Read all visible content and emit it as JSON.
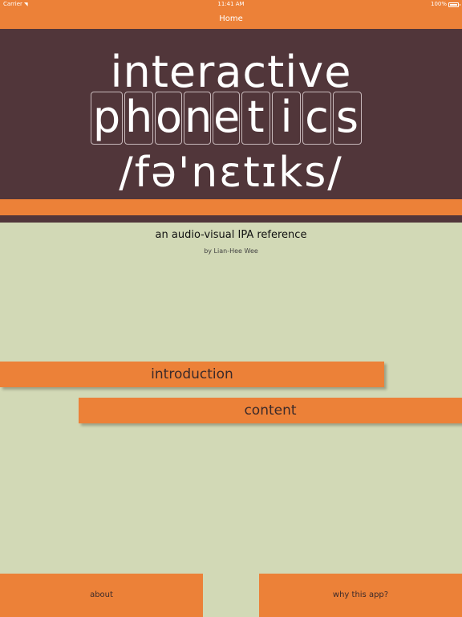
{
  "status_bar": {
    "carrier": "Carrier",
    "time": "11:41 AM",
    "battery": "100%"
  },
  "nav": {
    "title": "Home"
  },
  "hero": {
    "line1": "interactive",
    "letters": [
      "p",
      "h",
      "o",
      "n",
      "e",
      "t",
      "i",
      "c",
      "s"
    ],
    "ipa": "/fə'nɛtɪks/"
  },
  "subtitle": "an audio-visual IPA reference",
  "byline": "by Lian-Hee Wee",
  "menu": {
    "introduction": "introduction",
    "content": "content"
  },
  "bottom": {
    "about": "about",
    "why": "why this app?"
  },
  "colors": {
    "accent": "#ec8138",
    "hero_bg": "#51363a",
    "page_bg": "#d2d9b6"
  }
}
